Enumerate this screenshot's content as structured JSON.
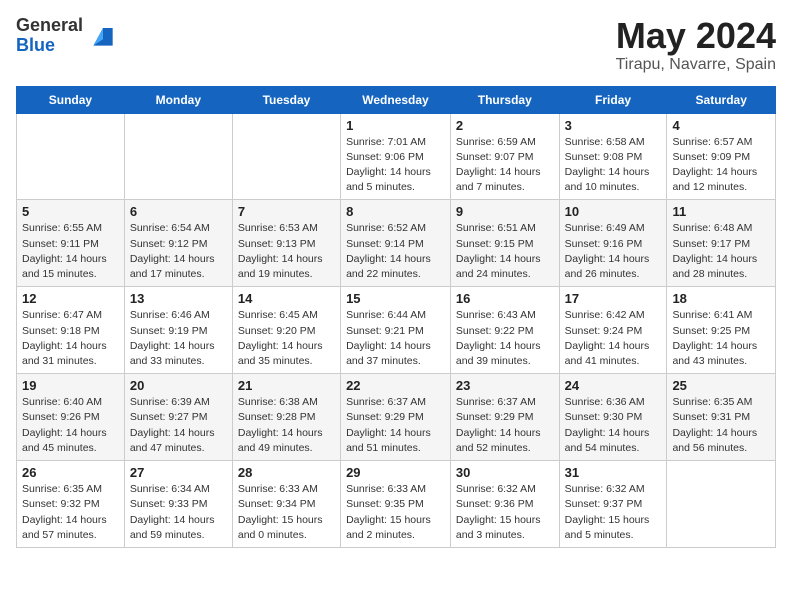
{
  "logo": {
    "general": "General",
    "blue": "Blue"
  },
  "title": "May 2024",
  "location": "Tirapu, Navarre, Spain",
  "days_of_week": [
    "Sunday",
    "Monday",
    "Tuesday",
    "Wednesday",
    "Thursday",
    "Friday",
    "Saturday"
  ],
  "weeks": [
    [
      {
        "day": "",
        "info": ""
      },
      {
        "day": "",
        "info": ""
      },
      {
        "day": "",
        "info": ""
      },
      {
        "day": "1",
        "info": "Sunrise: 7:01 AM\nSunset: 9:06 PM\nDaylight: 14 hours\nand 5 minutes."
      },
      {
        "day": "2",
        "info": "Sunrise: 6:59 AM\nSunset: 9:07 PM\nDaylight: 14 hours\nand 7 minutes."
      },
      {
        "day": "3",
        "info": "Sunrise: 6:58 AM\nSunset: 9:08 PM\nDaylight: 14 hours\nand 10 minutes."
      },
      {
        "day": "4",
        "info": "Sunrise: 6:57 AM\nSunset: 9:09 PM\nDaylight: 14 hours\nand 12 minutes."
      }
    ],
    [
      {
        "day": "5",
        "info": "Sunrise: 6:55 AM\nSunset: 9:11 PM\nDaylight: 14 hours\nand 15 minutes."
      },
      {
        "day": "6",
        "info": "Sunrise: 6:54 AM\nSunset: 9:12 PM\nDaylight: 14 hours\nand 17 minutes."
      },
      {
        "day": "7",
        "info": "Sunrise: 6:53 AM\nSunset: 9:13 PM\nDaylight: 14 hours\nand 19 minutes."
      },
      {
        "day": "8",
        "info": "Sunrise: 6:52 AM\nSunset: 9:14 PM\nDaylight: 14 hours\nand 22 minutes."
      },
      {
        "day": "9",
        "info": "Sunrise: 6:51 AM\nSunset: 9:15 PM\nDaylight: 14 hours\nand 24 minutes."
      },
      {
        "day": "10",
        "info": "Sunrise: 6:49 AM\nSunset: 9:16 PM\nDaylight: 14 hours\nand 26 minutes."
      },
      {
        "day": "11",
        "info": "Sunrise: 6:48 AM\nSunset: 9:17 PM\nDaylight: 14 hours\nand 28 minutes."
      }
    ],
    [
      {
        "day": "12",
        "info": "Sunrise: 6:47 AM\nSunset: 9:18 PM\nDaylight: 14 hours\nand 31 minutes."
      },
      {
        "day": "13",
        "info": "Sunrise: 6:46 AM\nSunset: 9:19 PM\nDaylight: 14 hours\nand 33 minutes."
      },
      {
        "day": "14",
        "info": "Sunrise: 6:45 AM\nSunset: 9:20 PM\nDaylight: 14 hours\nand 35 minutes."
      },
      {
        "day": "15",
        "info": "Sunrise: 6:44 AM\nSunset: 9:21 PM\nDaylight: 14 hours\nand 37 minutes."
      },
      {
        "day": "16",
        "info": "Sunrise: 6:43 AM\nSunset: 9:22 PM\nDaylight: 14 hours\nand 39 minutes."
      },
      {
        "day": "17",
        "info": "Sunrise: 6:42 AM\nSunset: 9:24 PM\nDaylight: 14 hours\nand 41 minutes."
      },
      {
        "day": "18",
        "info": "Sunrise: 6:41 AM\nSunset: 9:25 PM\nDaylight: 14 hours\nand 43 minutes."
      }
    ],
    [
      {
        "day": "19",
        "info": "Sunrise: 6:40 AM\nSunset: 9:26 PM\nDaylight: 14 hours\nand 45 minutes."
      },
      {
        "day": "20",
        "info": "Sunrise: 6:39 AM\nSunset: 9:27 PM\nDaylight: 14 hours\nand 47 minutes."
      },
      {
        "day": "21",
        "info": "Sunrise: 6:38 AM\nSunset: 9:28 PM\nDaylight: 14 hours\nand 49 minutes."
      },
      {
        "day": "22",
        "info": "Sunrise: 6:37 AM\nSunset: 9:29 PM\nDaylight: 14 hours\nand 51 minutes."
      },
      {
        "day": "23",
        "info": "Sunrise: 6:37 AM\nSunset: 9:29 PM\nDaylight: 14 hours\nand 52 minutes."
      },
      {
        "day": "24",
        "info": "Sunrise: 6:36 AM\nSunset: 9:30 PM\nDaylight: 14 hours\nand 54 minutes."
      },
      {
        "day": "25",
        "info": "Sunrise: 6:35 AM\nSunset: 9:31 PM\nDaylight: 14 hours\nand 56 minutes."
      }
    ],
    [
      {
        "day": "26",
        "info": "Sunrise: 6:35 AM\nSunset: 9:32 PM\nDaylight: 14 hours\nand 57 minutes."
      },
      {
        "day": "27",
        "info": "Sunrise: 6:34 AM\nSunset: 9:33 PM\nDaylight: 14 hours\nand 59 minutes."
      },
      {
        "day": "28",
        "info": "Sunrise: 6:33 AM\nSunset: 9:34 PM\nDaylight: 15 hours\nand 0 minutes."
      },
      {
        "day": "29",
        "info": "Sunrise: 6:33 AM\nSunset: 9:35 PM\nDaylight: 15 hours\nand 2 minutes."
      },
      {
        "day": "30",
        "info": "Sunrise: 6:32 AM\nSunset: 9:36 PM\nDaylight: 15 hours\nand 3 minutes."
      },
      {
        "day": "31",
        "info": "Sunrise: 6:32 AM\nSunset: 9:37 PM\nDaylight: 15 hours\nand 5 minutes."
      },
      {
        "day": "",
        "info": ""
      }
    ]
  ]
}
